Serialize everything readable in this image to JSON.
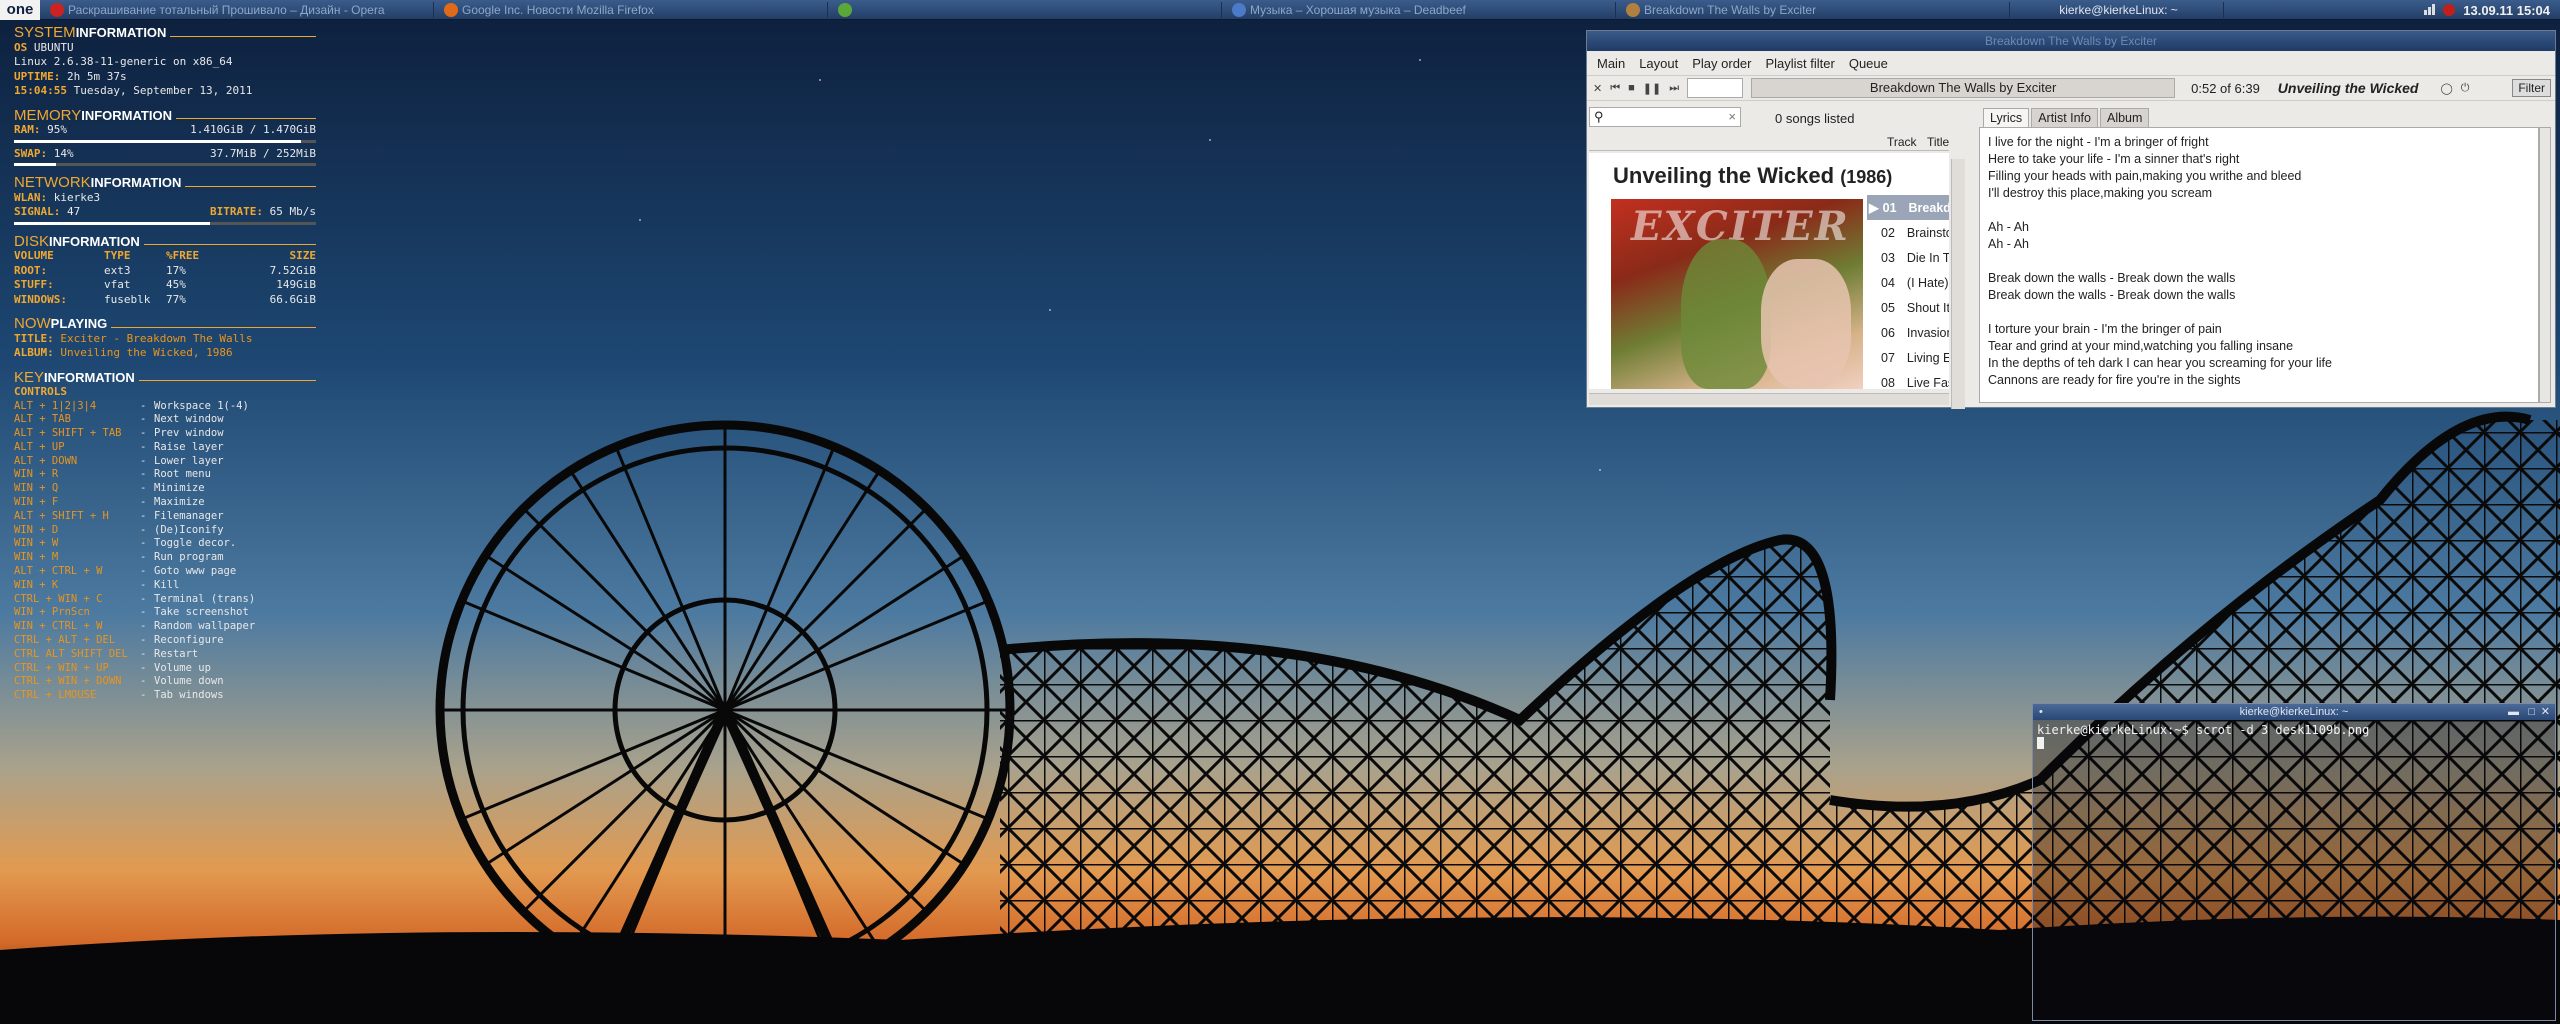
{
  "taskbar": {
    "start_label": "one",
    "tasks": [
      "Раскрашивание тотальный Прошивало – Дизайн - Opera",
      "",
      "Google Inc. Новости Mozilla Firefox",
      "",
      "",
      "Музыка – Хорошая музыка – Deadbeef",
      "Breakdown The Walls by Exciter",
      ""
    ],
    "user_host": "kierke@kierkeLinux: ~",
    "clock": "13.09.11 15:04"
  },
  "conky": {
    "system": {
      "h1": "SYSTEM",
      "h2": "INFORMATION",
      "os_label": "OS",
      "os": "UBUNTU",
      "kernel": "Linux 2.6.38-11-generic on x86_64",
      "uptime_label": "UPTIME:",
      "uptime": "2h 5m 37s",
      "time": "15:04:55",
      "date": "Tuesday, September 13, 2011"
    },
    "memory": {
      "h1": "MEMORY",
      "h2": "INFORMATION",
      "ram_label": "RAM:",
      "ram_pct": "95%",
      "ram_val": "1.410GiB / 1.470GiB",
      "ram_fill": 0.95,
      "swap_label": "SWAP:",
      "swap_pct": "14%",
      "swap_val": "37.7MiB / 252MiB",
      "swap_fill": 0.14
    },
    "network": {
      "h1": "NETWORK",
      "h2": "INFORMATION",
      "wlan_label": "WLAN:",
      "wlan": "kierke3",
      "signal_label": "SIGNAL:",
      "signal": "47",
      "bitrate_label": "BITRATE:",
      "bitrate": "65 Mb/s",
      "signal_fill": 0.65
    },
    "disk": {
      "h1": "DISK",
      "h2": "INFORMATION",
      "headers": [
        "VOLUME",
        "TYPE",
        "%FREE",
        "SIZE"
      ],
      "rows": [
        [
          "ROOT:",
          "ext3",
          "17%",
          "7.52GiB"
        ],
        [
          "STUFF:",
          "vfat",
          "45%",
          "149GiB"
        ],
        [
          "WINDOWS:",
          "fuseblk",
          "77%",
          "66.6GiB"
        ]
      ]
    },
    "nowplaying": {
      "h1": "NOW",
      "h2": "PLAYING",
      "title_label": "TITLE:",
      "artist": "Exciter",
      "title": "Breakdown The Walls",
      "album_label": "ALBUM:",
      "album": "Unveiling the Wicked",
      "year": "1986"
    },
    "keys": {
      "h1": "KEY",
      "h2": "INFORMATION",
      "controls": "CONTROLS",
      "rows": [
        [
          "ALT + 1|2|3|4",
          "Workspace 1(-4)"
        ],
        [
          "ALT + TAB",
          "Next window"
        ],
        [
          "ALT + SHIFT + TAB",
          "Prev window"
        ],
        [
          "ALT + UP",
          "Raise layer"
        ],
        [
          "ALT + DOWN",
          "Lower layer"
        ],
        [
          "WIN + R",
          "Root menu"
        ],
        [
          "WIN + Q",
          "Minimize"
        ],
        [
          "WIN + F",
          "Maximize"
        ],
        [
          "ALT + SHIFT + H",
          "Filemanager"
        ],
        [
          "WIN + D",
          "(De)Iconify"
        ],
        [
          "WIN + W",
          "Toggle decor."
        ],
        [
          "WIN + M",
          "Run program"
        ],
        [
          "ALT + CTRL + W",
          "Goto www page"
        ],
        [
          "WIN + K",
          "Kill"
        ],
        [
          "CTRL + WIN + C",
          "Terminal (trans)"
        ],
        [
          "WIN + PrnScn",
          "Take screenshot"
        ],
        [
          "WIN + CTRL + W",
          "Random wallpaper"
        ],
        [
          "CTRL + ALT + DEL",
          "Reconfigure"
        ],
        [
          "CTRL ALT SHIFT DEL",
          "Restart"
        ],
        [
          "CTRL + WIN + UP",
          "Volume up"
        ],
        [
          "CTRL + WIN + DOWN",
          "Volume down"
        ],
        [
          "CTRL + LMOUSE",
          "Tab windows"
        ]
      ]
    }
  },
  "player": {
    "window_title": "Breakdown The Walls by Exciter",
    "menu": [
      "Main",
      "Layout",
      "Play order",
      "Playlist filter",
      "Queue"
    ],
    "now_playing": "Breakdown The Walls by Exciter",
    "time": "0:52 of 6:39",
    "album_bold": "Unveiling the Wicked",
    "filter_btn": "Filter",
    "songs_listed": "0 songs listed",
    "col_track": "Track",
    "col_title": "Title",
    "album_title": "Unveiling the Wicked",
    "album_year": "(1986)",
    "cover_band": "EXCITER",
    "tracks": [
      {
        "n": "01",
        "t": "Breakdown The Walls"
      },
      {
        "n": "02",
        "t": "Brainstorm"
      },
      {
        "n": "03",
        "t": "Die In The Night"
      },
      {
        "n": "04",
        "t": "(I Hate) School Rules"
      },
      {
        "n": "05",
        "t": "Shout It Out"
      },
      {
        "n": "06",
        "t": "Invasion"
      },
      {
        "n": "07",
        "t": "Living Evil"
      },
      {
        "n": "08",
        "t": "Live Fast, Die Young"
      }
    ],
    "tabs": [
      "Lyrics",
      "Artist Info",
      "Album"
    ],
    "lyrics": [
      "I live for the night - I'm a bringer of fright",
      "Here to take your life - I'm a sinner that's right",
      "Filling your heads with pain,making you writhe and bleed",
      "I'll destroy this place,making you scream",
      "",
      "Ah - Ah",
      "Ah - Ah",
      "",
      "Break down the walls - Break down the walls",
      "Break down the walls - Break down the walls",
      "",
      "I torture your brain - I'm the bringer of pain",
      "Tear and grind at your mind,watching you falling insane",
      "In the depths of teh dark I can hear you screaming for your life",
      "Cannons are ready for fire you're in the sights"
    ]
  },
  "terminal": {
    "title": "kierke@kierkeLinux: ~",
    "prompt": "kierke@kierkeLinux:~$ scrot -d 3 desk1109b.png"
  }
}
